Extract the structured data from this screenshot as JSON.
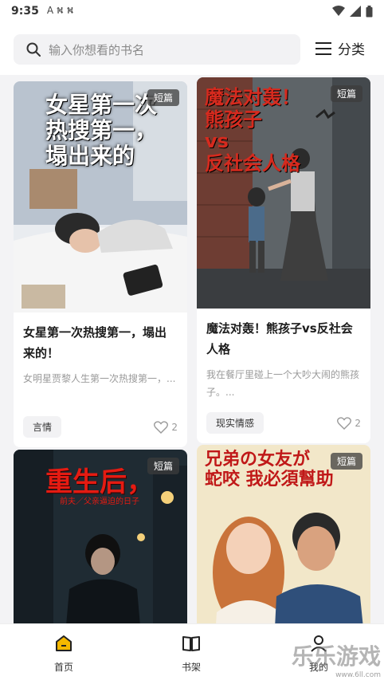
{
  "statusbar": {
    "time": "9:35",
    "notifications": "A ⛕ ⛕"
  },
  "search": {
    "placeholder": "输入你想看的书名"
  },
  "category": {
    "label": "分类"
  },
  "books": [
    {
      "tag": "短篇",
      "cover_text": "女星第一次\n热搜第一，\n塌出来的",
      "title": "女星第一次热搜第一，塌出来的！",
      "desc": "女明星贾黎人生第一次热搜第一，...",
      "genre": "言情",
      "likes": "2"
    },
    {
      "tag": "短篇",
      "cover_text": "魔法对轰！\n熊孩子\nvs\n反社会人格",
      "title": "魔法对轰！熊孩子vs反社会人格",
      "desc": "我在餐厅里碰上一个大吵大闹的熊孩子。...",
      "genre": "现实情感",
      "likes": "2"
    },
    {
      "tag": "短篇",
      "cover_text": "重生后，",
      "cover_sub": "前夫／父亲逼迫的日子",
      "title": "",
      "desc": "",
      "genre": "",
      "likes": ""
    },
    {
      "tag": "短篇",
      "cover_text": "兄弟の女友が\n蛇咬 我必須幫助",
      "title": "",
      "desc": "",
      "genre": "",
      "likes": ""
    }
  ],
  "tabs": [
    {
      "label": "首页",
      "icon": "home-icon",
      "active": true
    },
    {
      "label": "书架",
      "icon": "book-icon",
      "active": false
    },
    {
      "label": "我的",
      "icon": "user-icon",
      "active": false
    }
  ],
  "watermark": {
    "text": "乐乐游戏",
    "url": "www.6ll.com"
  },
  "colors": {
    "accent": "#f5b800",
    "background": "#f3f3f5"
  }
}
